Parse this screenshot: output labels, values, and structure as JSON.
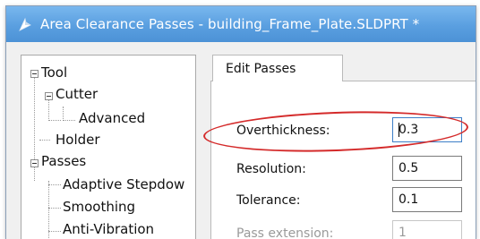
{
  "window": {
    "title": "Area Clearance Passes - building_Frame_Plate.SLDPRT *",
    "title_icon": "cutter-tool-icon"
  },
  "tree": {
    "items": [
      {
        "label": "Tool",
        "expanded": true
      },
      {
        "label": "Cutter",
        "expanded": true
      },
      {
        "label": "Advanced"
      },
      {
        "label": "Holder"
      },
      {
        "label": "Passes",
        "expanded": true
      },
      {
        "label": "Adaptive Stepdow"
      },
      {
        "label": "Smoothing"
      },
      {
        "label": "Anti-Vibration"
      }
    ]
  },
  "tabs": [
    {
      "label": "Edit Passes",
      "selected": true
    }
  ],
  "fields": {
    "overthickness": {
      "label": "Overthickness:",
      "value": "0.3"
    },
    "resolution": {
      "label": "Resolution:",
      "value": "0.5"
    },
    "tolerance": {
      "label": "Tolerance:",
      "value": "0.1"
    },
    "pass_extension": {
      "label": "Pass extension:",
      "value": "1",
      "enabled": false
    }
  },
  "colors": {
    "titlebar": "#5a9fe0",
    "highlight_ellipse": "#d42a2a"
  }
}
